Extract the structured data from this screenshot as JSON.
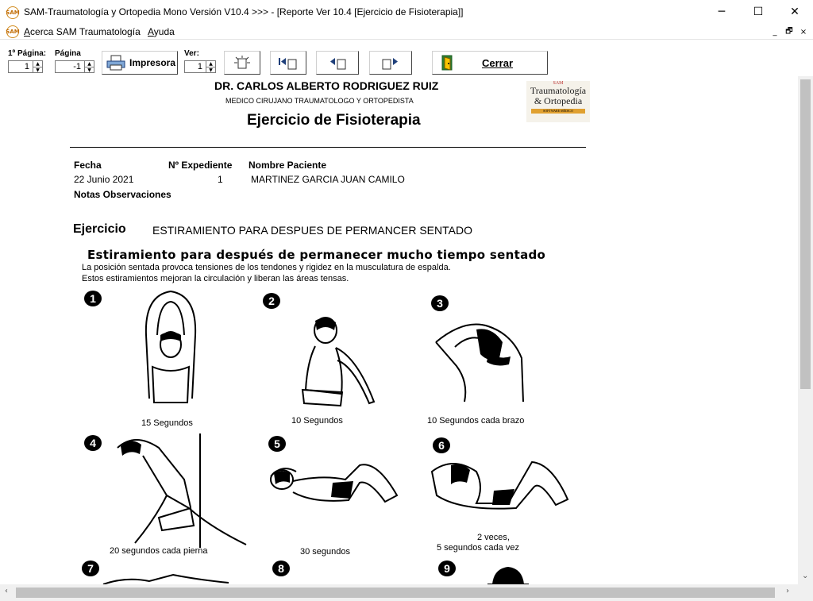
{
  "window": {
    "title": "SAM-Traumatología y Ortopedia Mono Versión V10.4 >>> - [Reporte Ver  10.4  [Ejercicio de Fisioterapia]]",
    "app_icon": "SAM",
    "controls": {
      "minimize": "─",
      "maximize": "☐",
      "close": "✕"
    }
  },
  "menu": {
    "items": [
      "Acerca SAM Traumatología",
      "Ayuda"
    ],
    "mdi": {
      "minimize": "_",
      "restore": "🗗",
      "close": "×"
    }
  },
  "toolbar": {
    "first_page_label": "1º Página:",
    "first_page_value": "1",
    "page_label": "Página",
    "page_value": "-1",
    "print_label": "Impresora",
    "view_label": "Ver:",
    "view_value": "1",
    "close_label": "Cerrar"
  },
  "report": {
    "doctor_name": "DR. CARLOS ALBERTO RODRIGUEZ RUIZ",
    "doctor_title": "MEDICO CIRUJANO TRAUMATOLOGO Y ORTOPEDISTA",
    "report_title": "Ejercicio de Fisioterapia",
    "logo": {
      "line1": "SAM",
      "line2": "Traumatología",
      "line3": "& Ortopedia",
      "line4": "SOFTWARE MÉDICO"
    },
    "headers": {
      "date": "Fecha",
      "file": "Nº Expediente",
      "patient": "Nombre Paciente",
      "notes": "Notas Observaciones"
    },
    "values": {
      "date": "22 Junio 2021",
      "file": "1",
      "patient": "MARTINEZ GARCIA JUAN CAMILO"
    },
    "exercise_label": "Ejercicio",
    "exercise_name": "ESTIRAMIENTO PARA DESPUES DE PERMANCER SENTADO",
    "sheet": {
      "title": "Estiramiento para después de permanecer mucho tiempo sentado",
      "line1": "La posición sentada provoca tensiones de los tendones y rigidez en la musculatura de espalda.",
      "line2": "Estos estiramientos mejoran la circulación y liberan las áreas tensas.",
      "steps": [
        {
          "num": "1",
          "caption": "15 Segundos"
        },
        {
          "num": "2",
          "caption": "10 Segundos"
        },
        {
          "num": "3",
          "caption": "10 Segundos cada brazo"
        },
        {
          "num": "4",
          "caption": "20 segundos cada pierna"
        },
        {
          "num": "5",
          "caption": "30 segundos"
        },
        {
          "num": "6",
          "caption": "2 veces,",
          "caption2": "5 segundos cada vez"
        },
        {
          "num": "7"
        },
        {
          "num": "8"
        },
        {
          "num": "9"
        }
      ]
    }
  },
  "scroll": {
    "left": "‹",
    "right": "›",
    "down": "⌄"
  }
}
